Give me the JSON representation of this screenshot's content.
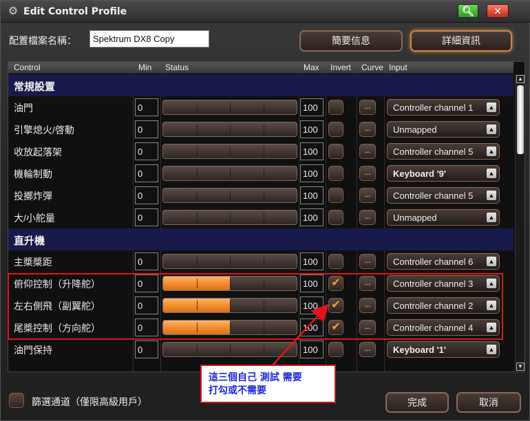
{
  "window": {
    "title": "Edit Control Profile"
  },
  "profile": {
    "label": "配置檔案名稱：",
    "value": "Spektrum DX8 Copy"
  },
  "top_buttons": {
    "simple": "簡要信息",
    "detail": "詳細資訊"
  },
  "columns": {
    "control": "Control",
    "min": "Min",
    "status": "Status",
    "max": "Max",
    "invert": "Invert",
    "curve": "Curve",
    "input": "Input"
  },
  "rows": [
    {
      "type": "section",
      "label": "常規設置"
    },
    {
      "type": "control",
      "name": "油門",
      "min": "0",
      "max": "100",
      "fill": 0,
      "inverted": false,
      "curve": "...",
      "input": "Controller channel 1",
      "bold": false
    },
    {
      "type": "control",
      "name": "引擎熄火/啓動",
      "min": "0",
      "max": "100",
      "fill": 0,
      "inverted": false,
      "curve": "...",
      "input": "Unmapped",
      "bold": false
    },
    {
      "type": "control",
      "name": "收放起落架",
      "min": "0",
      "max": "100",
      "fill": 0,
      "inverted": false,
      "curve": "...",
      "input": "Controller channel 5",
      "bold": false
    },
    {
      "type": "control",
      "name": "機輪制動",
      "min": "0",
      "max": "100",
      "fill": 0,
      "inverted": false,
      "curve": "...",
      "input": "Keyboard '9'",
      "bold": true
    },
    {
      "type": "control",
      "name": "投擲炸彈",
      "min": "0",
      "max": "100",
      "fill": 0,
      "inverted": false,
      "curve": "...",
      "input": "Controller channel 5",
      "bold": false
    },
    {
      "type": "control",
      "name": "大/小舵量",
      "min": "0",
      "max": "100",
      "fill": 0,
      "inverted": false,
      "curve": "...",
      "input": "Unmapped",
      "bold": false
    },
    {
      "type": "section",
      "label": "直升機"
    },
    {
      "type": "control",
      "name": "主槳槳距",
      "min": "0",
      "max": "100",
      "fill": 0,
      "inverted": false,
      "curve": "...",
      "input": "Controller channel 6",
      "bold": false
    },
    {
      "type": "control",
      "name": "俯仰控制（升降舵）",
      "min": "0",
      "max": "100",
      "fill": 0.5,
      "inverted": true,
      "curve": "...",
      "input": "Controller channel 3",
      "bold": false
    },
    {
      "type": "control",
      "name": "左右側飛（副翼舵）",
      "min": "0",
      "max": "100",
      "fill": 0.5,
      "inverted": true,
      "curve": "...",
      "input": "Controller channel 2",
      "bold": false
    },
    {
      "type": "control",
      "name": "尾槳控制（方向舵）",
      "min": "0",
      "max": "100",
      "fill": 0.5,
      "inverted": true,
      "curve": "...",
      "input": "Controller channel 4",
      "bold": false
    },
    {
      "type": "control",
      "name": "油門保持",
      "min": "0",
      "max": "100",
      "fill": 0,
      "inverted": false,
      "curve": "...",
      "input": "Keyboard '1'",
      "bold": true
    }
  ],
  "annotation": {
    "line1": "這三個自己 測試 需要",
    "line2": "打勾或不需要"
  },
  "filter": {
    "label": "篩選通道（僅限高級用戶）"
  },
  "bottom_buttons": {
    "done": "完成",
    "cancel": "取消"
  },
  "icons": {
    "app": "gear-icon",
    "search": "search-icon",
    "close": "close-icon"
  }
}
